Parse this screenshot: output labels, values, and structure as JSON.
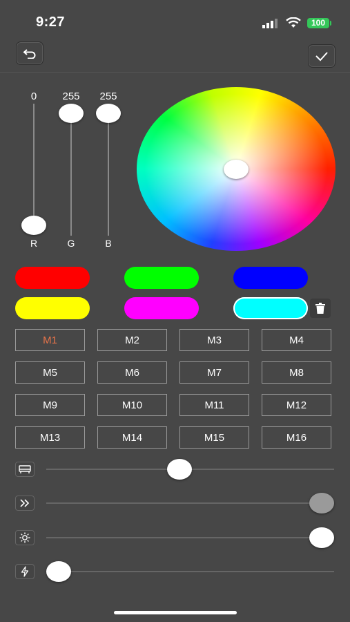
{
  "status_bar": {
    "time": "9:27",
    "battery": "100"
  },
  "rgb": {
    "r": {
      "label": "R",
      "value": "0"
    },
    "g": {
      "label": "G",
      "value": "255"
    },
    "b": {
      "label": "B",
      "value": "255"
    }
  },
  "color_presets": [
    "#ff0000",
    "#00ff00",
    "#0000ff",
    "#ffff00",
    "#ff00ff",
    "#00ffff"
  ],
  "selected_preset": "#00ffff",
  "modes": [
    "M1",
    "M2",
    "M3",
    "M4",
    "M5",
    "M6",
    "M7",
    "M8",
    "M9",
    "M10",
    "M11",
    "M12",
    "M13",
    "M14",
    "M15",
    "M16"
  ],
  "active_mode": "M1",
  "sliders": {
    "mode_value": 0.46,
    "speed_value": 1.0,
    "brightness_value": 1.0,
    "power_value": 0.0
  },
  "icons": {
    "back": "undo-icon",
    "confirm": "checkmark-icon",
    "delete": "trash-icon",
    "mode": "sofa-icon",
    "speed": "double-chevron-icon",
    "brightness": "sun-icon",
    "power": "lightning-icon"
  },
  "colors": {
    "background": "#474747",
    "accent_active_mode": "#e8744a"
  }
}
